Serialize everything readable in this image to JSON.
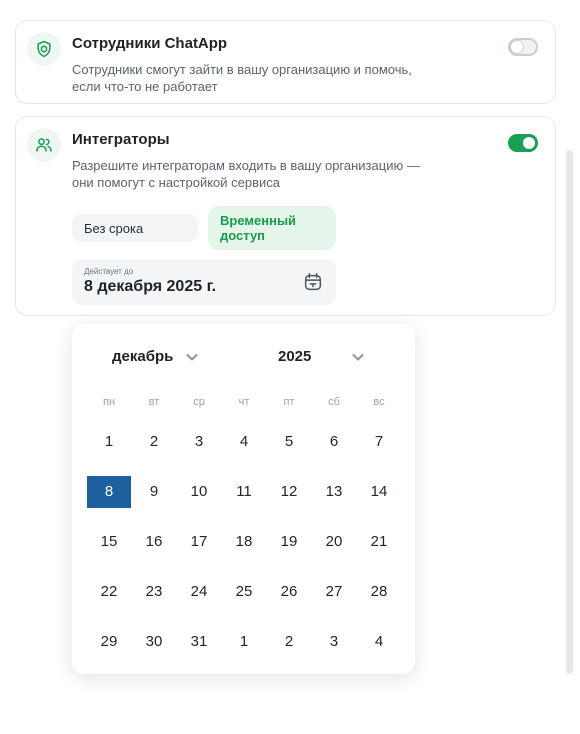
{
  "staff": {
    "title": "Сотрудники ChatApp",
    "desc": "Сотрудники смогут зайти в вашу организацию и помочь, если что-то не работает",
    "enabled": false
  },
  "integrators": {
    "title": "Интеграторы",
    "desc": "Разрешите интеграторам входить в вашу организацию — они помогут с настройкой сервиса",
    "enabled": true,
    "option_forever": "Без срока",
    "option_temporary": "Временный доступ",
    "date_label": "Действует до",
    "date_value": "8 декабря 2025 г."
  },
  "calendar": {
    "month": "декабрь",
    "year": "2025",
    "weekdays": [
      "пн",
      "вт",
      "ср",
      "чт",
      "пт",
      "сб",
      "вс"
    ],
    "weeks": [
      [
        "1",
        "2",
        "3",
        "4",
        "5",
        "6",
        "7"
      ],
      [
        "8",
        "9",
        "10",
        "11",
        "12",
        "13",
        "14"
      ],
      [
        "15",
        "16",
        "17",
        "18",
        "19",
        "20",
        "21"
      ],
      [
        "22",
        "23",
        "24",
        "25",
        "26",
        "27",
        "28"
      ],
      [
        "29",
        "30",
        "31",
        "1",
        "2",
        "3",
        "4"
      ]
    ],
    "selected_day": "8"
  },
  "colors": {
    "accent_green": "#1aa053",
    "selected_blue": "#1e5f9e"
  }
}
